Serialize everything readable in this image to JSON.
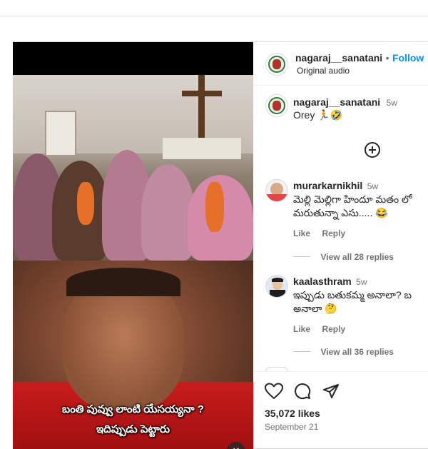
{
  "post": {
    "author": {
      "username": "nagaraj__sanatani",
      "follow_label": "Follow",
      "separator": "•",
      "audio": "Original audio"
    },
    "caption": {
      "username": "nagaraj__sanatani",
      "time": "5w",
      "text": "Orey 🏃🤣"
    },
    "media": {
      "subtitle_line1": "బంతి పువ్వు లాంటి యేసయ్యనా ?",
      "subtitle_line2": "ఇదిప్పుడు పెట్టారు"
    },
    "comments": [
      {
        "username": "murarkarnikhil",
        "time": "5w",
        "line1": "మెల్లి మెల్లిగా హిందూ మతం లో",
        "line2": "మరుతున్నా ఎసు..... 😂",
        "like_label": "Like",
        "reply_label": "Reply",
        "view_replies": "View all 28 replies"
      },
      {
        "username": "kaalasthram",
        "time": "5w",
        "line1": "ఇప్పుడు బతుకమ్మ అనాలా? బ",
        "line2": "అనాలా 🤔",
        "like_label": "Like",
        "reply_label": "Reply",
        "view_replies": "View all 36 replies"
      }
    ],
    "likes": "35,072 likes",
    "date": "September 21",
    "colors": {
      "link_blue": "#0095f6",
      "text": "#262626",
      "muted": "#737373",
      "border": "#dbdbdb"
    }
  }
}
